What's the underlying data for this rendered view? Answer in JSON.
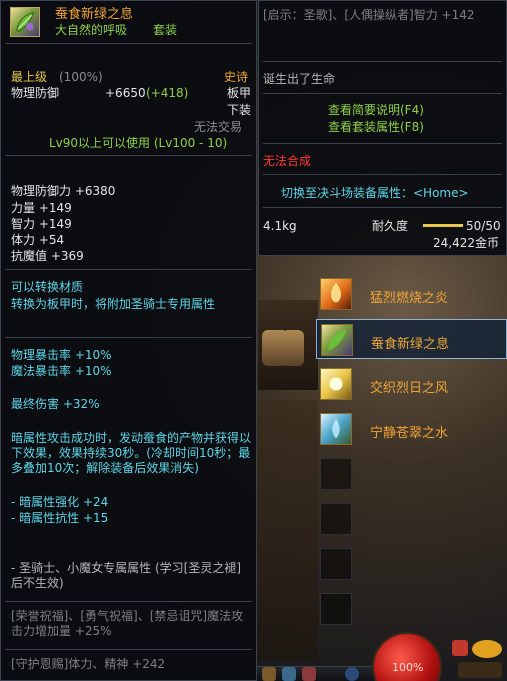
{
  "item": {
    "name": "蚕食新绿之息",
    "set_name": "大自然的呼吸",
    "set_tag": "套装"
  },
  "header_left": {
    "tier": "最上级",
    "tier_pct": "(100%)",
    "rarity": "史诗",
    "phys_def_label": "物理防御",
    "phys_def_value": "+6650",
    "phys_def_bonus": "(+418)",
    "slot_type": "板甲",
    "slot_part": "下装",
    "trade": "无法交易",
    "level_req": "Lv90以上可以使用 (Lv100 - 10)"
  },
  "stats": {
    "phys_def_power": "物理防御力 +6380",
    "str": "力量 +149",
    "int": "智力 +149",
    "vit": "体力 +54",
    "resist": "抗魔值 +369"
  },
  "convert": {
    "line1": "可以转换材质",
    "line2": "转换为板甲时，将附加圣骑士专用属性"
  },
  "crit": {
    "phys": "物理暴击率 +10%",
    "magic": "魔法暴击率 +10%"
  },
  "final_dmg": "最终伤害 +32%",
  "effect": {
    "text": "暗属性攻击成功时，发动蚕食的产物并获得以下效果，效果持续30秒。(冷却时间10秒；最多叠加10次；解除装备后效果消失)",
    "dark_str": "- 暗属性强化 +24",
    "dark_res": "- 暗属性抗性 +15"
  },
  "class_note": "- 圣骑士、小魔女专属属性 (学习[圣灵之褪]后不生效)",
  "skills": {
    "line1": "[荣誉祝福]、[勇气祝福]、[禁忌诅咒]魔法攻击力增加量 +25%",
    "line2": "[守护恩赐]体力、精神 +242"
  },
  "right": {
    "hint": "[启示：圣歌]、[人偶操纵者]智力 +142",
    "birth": "诞生出了生命",
    "view_desc": "查看简要说明(F4)",
    "view_set": "查看套装属性(F8)",
    "no_synth": "无法合成",
    "switch": "切换至决斗场装备属性：<Home>",
    "weight": "4.1kg",
    "durability_label": "耐久度",
    "durability": "50/50",
    "durability_fraction": 1.0,
    "price": "24,422金币"
  },
  "set_items": [
    {
      "label": "猛烈燃烧之炎",
      "icon": "flame-icon",
      "active": false
    },
    {
      "label": "蚕食新绿之息",
      "icon": "leaf-wind-icon",
      "active": true
    },
    {
      "label": "交织烈日之风",
      "icon": "sun-wind-icon",
      "active": false
    },
    {
      "label": "宁静苍翠之水",
      "icon": "water-icon",
      "active": false
    }
  ],
  "hud": {
    "hp": "100%"
  },
  "colors": {
    "epic": "#f0a535",
    "green_text": "#8fd04a",
    "cyan_text": "#5fd5e8",
    "red_text": "#ff3a30"
  }
}
